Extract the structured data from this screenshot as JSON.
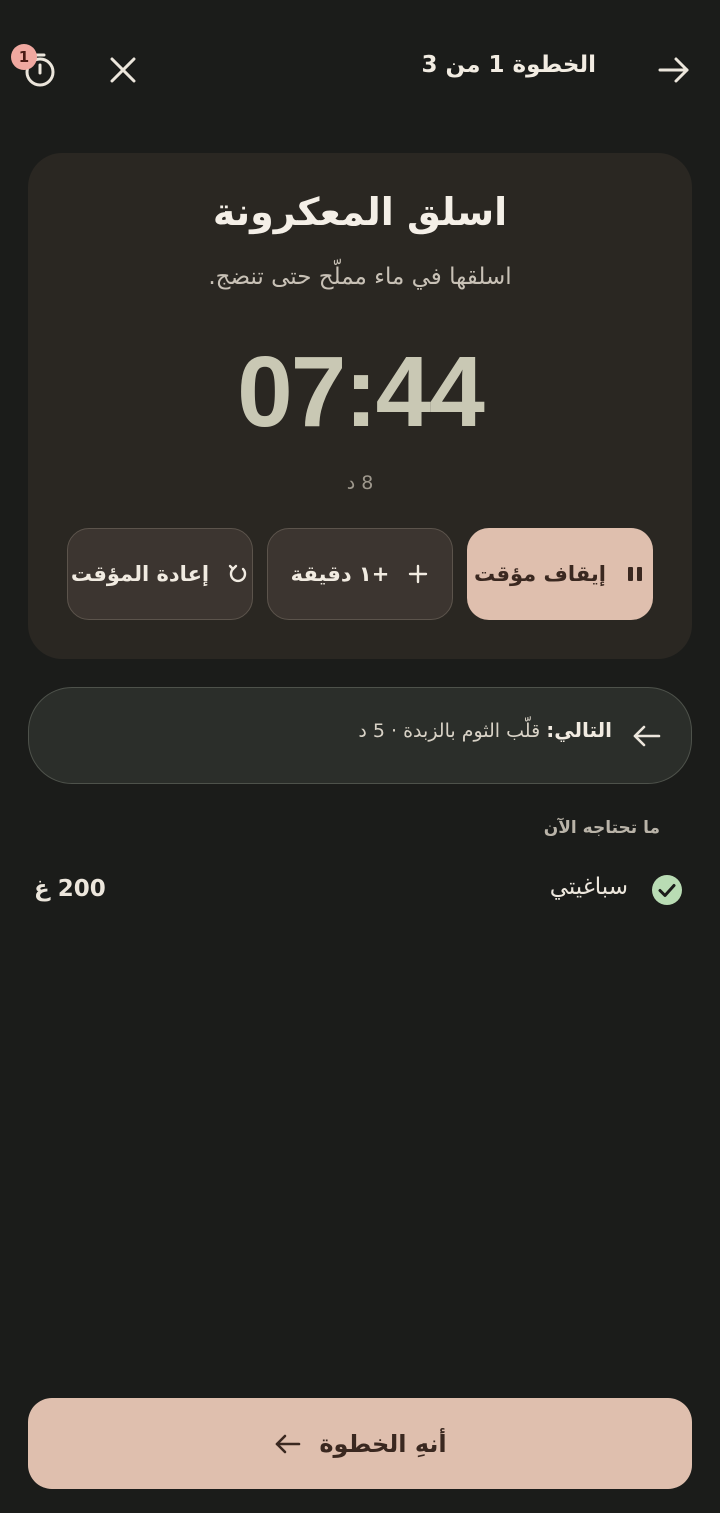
{
  "header": {
    "step_label": "الخطوة 1 من 3",
    "timer_badge_count": "1"
  },
  "card": {
    "title": "اسلق المعكرونة",
    "subtitle": "اسلقها في ماء مملّح حتى تنضج.",
    "timer": "07:44",
    "duration": "8 د"
  },
  "controls": {
    "pause_label": "إيقاف مؤقت",
    "add_minute_label": "+١ دقيقة",
    "reset_label": "إعادة المؤقت"
  },
  "next": {
    "label": "التالي:",
    "text": "قلّب الثوم بالزبدة · 5 د"
  },
  "ingredients": {
    "heading": "ما تحتاجه الآن",
    "items": [
      {
        "name": "سباغيتي",
        "quantity": "200 غ",
        "checked": true
      }
    ]
  },
  "footer": {
    "finish_label": "أنهِ الخطوة"
  },
  "colors": {
    "background": "#1b1c1a",
    "card": "#2a2722",
    "accent": "#dfbfae",
    "timer_digits": "#c9c8b4",
    "check": "#b9dcb4",
    "badge": "#f0a8a0"
  },
  "icons": {
    "timer": "stopwatch-icon",
    "close": "close-icon",
    "next_step": "arrow-right-icon",
    "pause": "pause-icon",
    "add": "plus-icon",
    "reset": "restart-icon",
    "next_arrow": "arrow-left-icon",
    "check": "check-circle-icon",
    "finish": "arrow-left-icon"
  }
}
